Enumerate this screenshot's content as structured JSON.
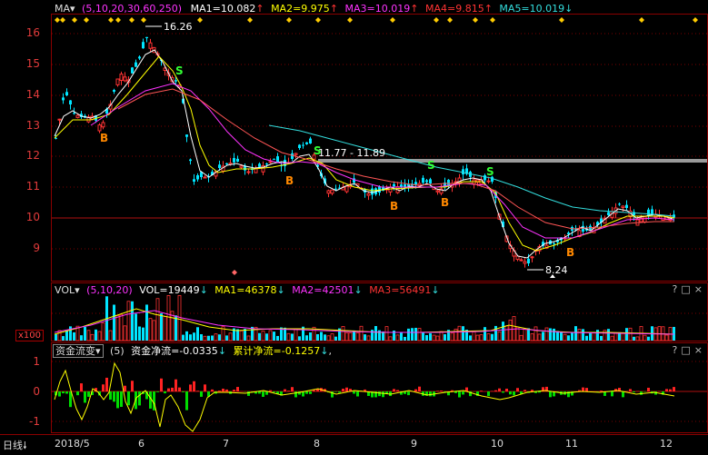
{
  "header": {
    "ma_dropdown": "MA",
    "ma_params": "(5,10,20,30,60,250)",
    "ma1": "MA1=10.082",
    "ma2": "MA2=9.975",
    "ma3": "MA3=10.019",
    "ma4": "MA4=9.815",
    "ma5": "MA5=10.019",
    "arrow_up": "↑",
    "arrow_down": "↓"
  },
  "price_axis": {
    "labels": [
      "16",
      "15",
      "14",
      "13",
      "12",
      "11",
      "10",
      "9"
    ]
  },
  "annotations": {
    "high": "16.26",
    "low": "8.24",
    "range": "11.77 - 11.89",
    "buy": "B",
    "sell": "S"
  },
  "volume_header": {
    "dropdown": "VOL",
    "params": "(5,10,20)",
    "vol": "VOL=19449",
    "ma1": "MA1=46378",
    "ma2": "MA2=42501",
    "ma3": "MA3=56491",
    "unit": "x100"
  },
  "flow_header": {
    "dropdown": "资金流变",
    "params": "(5)",
    "net": "资金净流=-0.0335",
    "cum": "累计净流=-0.1257",
    "tail": ","
  },
  "flow_axis": {
    "labels": [
      "1",
      "0",
      "-1"
    ]
  },
  "panel_controls": "?□×",
  "footer": {
    "period": "日线",
    "dates": [
      "2018/5",
      "6",
      "7",
      "8",
      "9",
      "10",
      "11",
      "12"
    ]
  },
  "colors": {
    "up": "#ff3333",
    "down": "#00e5ff",
    "grid": "#8b0000",
    "ma_white": "#ffffff",
    "ma_yellow": "#ffff00",
    "ma_magenta": "#ff33ff",
    "ma_green": "#00cc00",
    "ma_cyan": "#33dddd"
  }
}
